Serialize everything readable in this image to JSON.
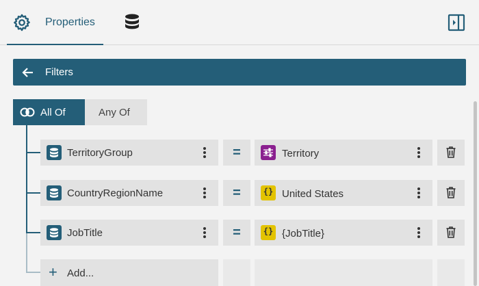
{
  "tabs": {
    "properties_label": "Properties",
    "properties_icon": "gear-icon",
    "data_icon": "database-icon",
    "panel_toggle_icon": "panel-right-icon"
  },
  "filters": {
    "title": "Filters",
    "back_icon": "arrow-left-icon",
    "modes": [
      {
        "label": "All Of",
        "selected": true,
        "icon": "venn-icon"
      },
      {
        "label": "Any Of",
        "selected": false
      }
    ],
    "rows": [
      {
        "field": "TerritoryGroup",
        "operator": "=",
        "value": "Territory",
        "value_type": "parameter"
      },
      {
        "field": "CountryRegionName",
        "operator": "=",
        "value": "United States",
        "value_type": "variable"
      },
      {
        "field": "JobTitle",
        "operator": "=",
        "value": "{JobTitle}",
        "value_type": "variable"
      }
    ],
    "variable_badge": "{}",
    "add_label": "Add...",
    "add_icon": "plus-icon"
  },
  "colors": {
    "accent": "#245e78",
    "parameter": "#8a1f8f",
    "variable": "#e3c300",
    "row_bg": "#e2e2e2"
  }
}
